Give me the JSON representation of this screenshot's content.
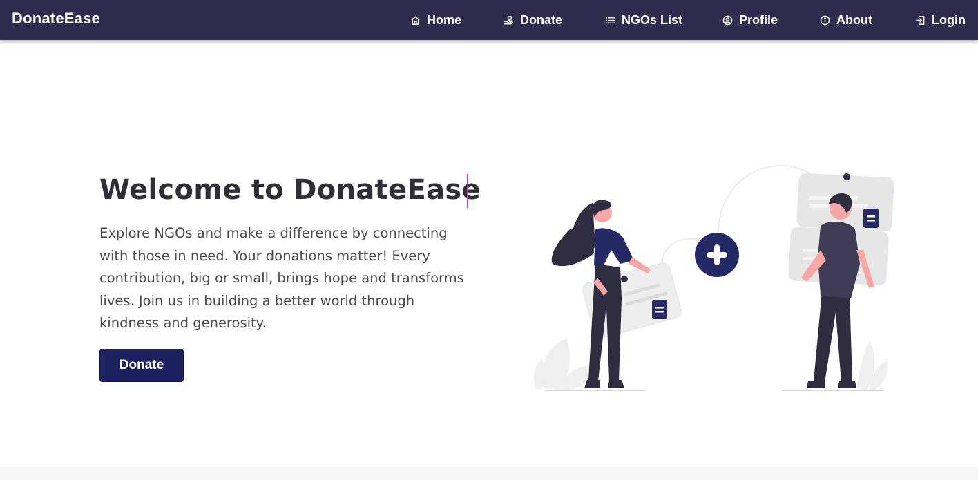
{
  "app": {
    "brand": "DonateEase"
  },
  "nav": {
    "items": [
      {
        "label": "Home",
        "icon": "home-icon"
      },
      {
        "label": "Donate",
        "icon": "donate-hand-icon"
      },
      {
        "label": "NGOs List",
        "icon": "list-icon"
      },
      {
        "label": "Profile",
        "icon": "user-circle-icon"
      },
      {
        "label": "About",
        "icon": "info-icon"
      },
      {
        "label": "Login",
        "icon": "login-icon"
      }
    ]
  },
  "hero": {
    "title": "Welcome to DonateEase",
    "description": "Explore NGOs and make a difference by connecting with those in need. Your donations matter! Every contribution, big or small, brings hope and transforms lives. Join us in building a better world through kindness and generosity.",
    "button_label": "Donate"
  },
  "colors": {
    "navbar": "#2e2d4d",
    "button": "#1c2260",
    "caret": "#e0309a",
    "illustration_accent": "#242a66",
    "skin": "#f7a8a6"
  }
}
